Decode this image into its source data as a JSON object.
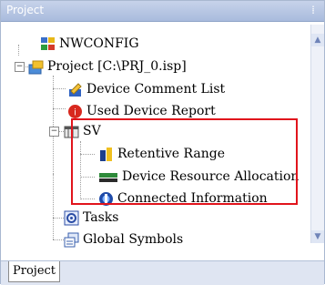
{
  "panel": {
    "title": "Project",
    "pin_glyph": "⁞"
  },
  "tree": {
    "items": [
      {
        "label": "NWCONFIG",
        "icon": "network-config-icon"
      },
      {
        "label": "Project [C:\\PRJ_0.isp]",
        "icon": "project-icon"
      },
      {
        "label": "Device Comment List",
        "icon": "comment-list-icon"
      },
      {
        "label": "Used Device Report",
        "icon": "report-icon"
      },
      {
        "label": "SV",
        "icon": "sv-icon"
      },
      {
        "label": "Retentive Range",
        "icon": "retentive-range-icon"
      },
      {
        "label": "Device Resource Allocation",
        "icon": "resource-allocation-icon"
      },
      {
        "label": "Connected Information",
        "icon": "connected-info-icon"
      },
      {
        "label": "Tasks",
        "icon": "tasks-icon"
      },
      {
        "label": "Global Symbols",
        "icon": "global-symbols-icon"
      }
    ],
    "expander_project": "−",
    "expander_sv": "−"
  },
  "highlight_color": "#e1141c",
  "tabs": [
    {
      "label": "Project"
    }
  ]
}
